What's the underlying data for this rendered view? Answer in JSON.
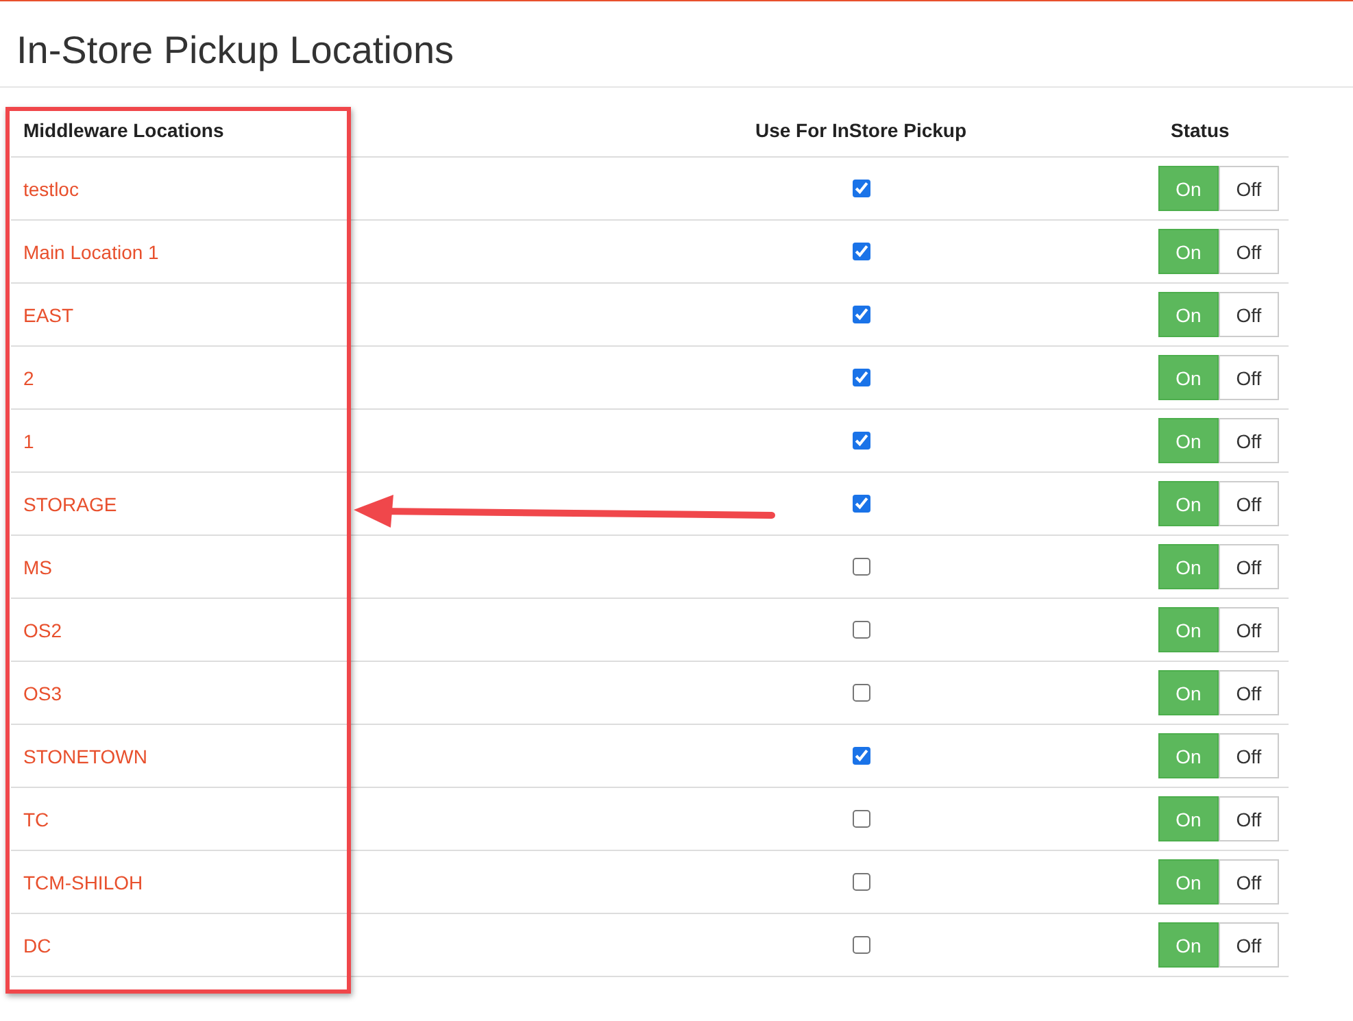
{
  "title": "In-Store Pickup Locations",
  "table": {
    "columns": [
      "Middleware Locations",
      "Use For InStore Pickup",
      "Status"
    ],
    "rows": [
      {
        "name": "testloc",
        "pickup": true,
        "on": true,
        "on_label": "On",
        "off_label": "Off"
      },
      {
        "name": "Main Location 1",
        "pickup": true,
        "on": true,
        "on_label": "On",
        "off_label": "Off"
      },
      {
        "name": "EAST",
        "pickup": true,
        "on": true,
        "on_label": "On",
        "off_label": "Off"
      },
      {
        "name": "2",
        "pickup": true,
        "on": true,
        "on_label": "On",
        "off_label": "Off"
      },
      {
        "name": "1",
        "pickup": true,
        "on": true,
        "on_label": "On",
        "off_label": "Off"
      },
      {
        "name": "STORAGE",
        "pickup": true,
        "on": true,
        "on_label": "On",
        "off_label": "Off"
      },
      {
        "name": "MS",
        "pickup": false,
        "on": true,
        "on_label": "On",
        "off_label": "Off"
      },
      {
        "name": "OS2",
        "pickup": false,
        "on": true,
        "on_label": "On",
        "off_label": "Off"
      },
      {
        "name": "OS3",
        "pickup": false,
        "on": true,
        "on_label": "On",
        "off_label": "Off"
      },
      {
        "name": "STONETOWN",
        "pickup": true,
        "on": true,
        "on_label": "On",
        "off_label": "Off"
      },
      {
        "name": "TC",
        "pickup": false,
        "on": true,
        "on_label": "On",
        "off_label": "Off"
      },
      {
        "name": "TCM-SHILOH",
        "pickup": false,
        "on": true,
        "on_label": "On",
        "off_label": "Off"
      },
      {
        "name": "DC",
        "pickup": false,
        "on": true,
        "on_label": "On",
        "off_label": "Off"
      }
    ]
  }
}
